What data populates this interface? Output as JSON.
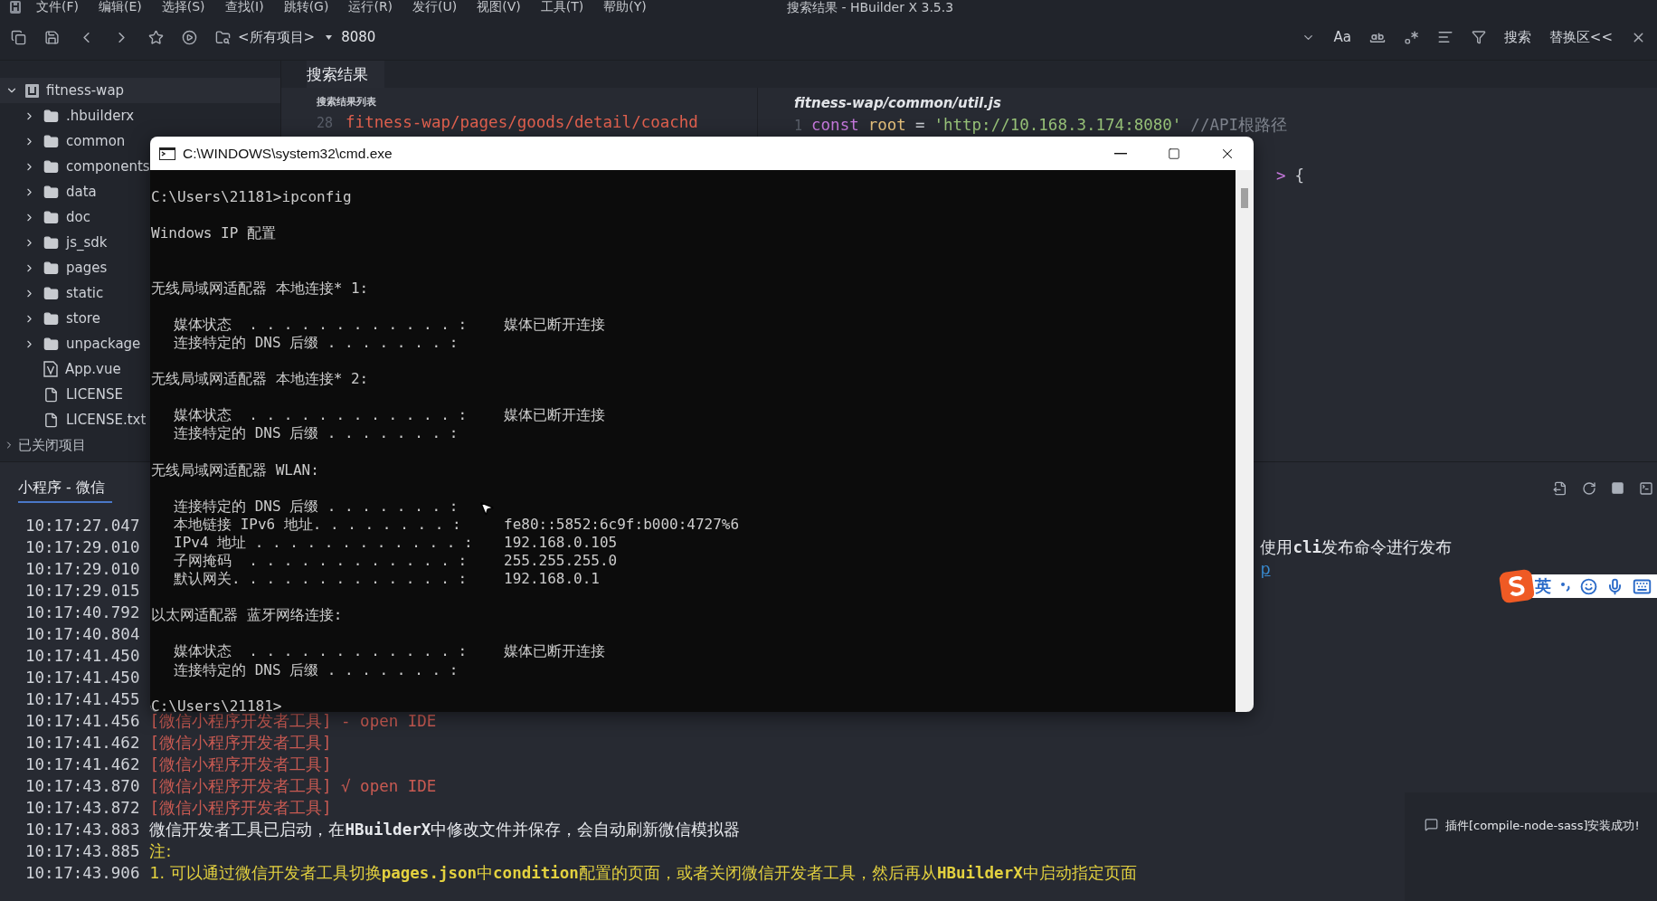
{
  "menu_bar": {
    "items": [
      "文件(F)",
      "编辑(E)",
      "选择(S)",
      "查找(I)",
      "跳转(G)",
      "运行(R)",
      "发行(U)",
      "视图(V)",
      "工具(T)",
      "帮助(Y)"
    ],
    "title": "搜索结果 - HBuilder X 3.5.3"
  },
  "toolbar": {
    "project_selector": "<所有项目>",
    "search_text": "8080",
    "match_case": "Aa",
    "search_button": "搜索",
    "replace_toggle": "替换区<<"
  },
  "sidebar": {
    "project": {
      "name": "fitness-wap",
      "expanded": true,
      "selected": true,
      "children": [
        {
          "name": ".hbuilderx",
          "kind": "folder",
          "expanded": false,
          "selected": false
        },
        {
          "name": "common",
          "kind": "folder",
          "expanded": false,
          "selected": false
        },
        {
          "name": "components",
          "kind": "folder",
          "expanded": false,
          "selected": false
        },
        {
          "name": "data",
          "kind": "folder",
          "expanded": false,
          "selected": false
        },
        {
          "name": "doc",
          "kind": "folder",
          "expanded": false,
          "selected": false
        },
        {
          "name": "js_sdk",
          "kind": "folder",
          "expanded": false,
          "selected": false
        },
        {
          "name": "pages",
          "kind": "folder",
          "expanded": false,
          "selected": false
        },
        {
          "name": "static",
          "kind": "folder",
          "expanded": false,
          "selected": false
        },
        {
          "name": "store",
          "kind": "folder",
          "expanded": false,
          "selected": false
        },
        {
          "name": "unpackage",
          "kind": "folder",
          "expanded": false,
          "selected": false
        },
        {
          "name": "App.vue",
          "kind": "vue",
          "selected": false
        },
        {
          "name": "LICENSE",
          "kind": "file",
          "selected": false
        },
        {
          "name": "LICENSE.txt",
          "kind": "file",
          "selected": false
        }
      ]
    },
    "closed_projects": {
      "label": "已关闭项目",
      "expanded": false
    }
  },
  "search_panel": {
    "tab": "搜索结果",
    "list_title": "搜索结果列表",
    "results": [
      {
        "line": "28",
        "text": "fitness-wap/pages/goods/detail/coachd"
      }
    ]
  },
  "editor": {
    "file_path": "fitness-wap/common/util.js",
    "lines": [
      {
        "number": "1",
        "tokens": [
          {
            "kind": "keyword",
            "text": "const"
          },
          {
            "kind": "name",
            "text": "root"
          },
          {
            "kind": "plain",
            "text": "="
          },
          {
            "kind": "string",
            "text": "'http://10.168.3.174:8080'"
          },
          {
            "kind": "comment",
            "text": "//API根路径"
          }
        ]
      },
      {
        "kind": "tail",
        "tokens": [
          {
            "kind": "keyword",
            "text": ">"
          },
          {
            "kind": "plain",
            "text": "{"
          }
        ]
      }
    ]
  },
  "console": {
    "tab": {
      "label": "小程序 - 微信",
      "selected": true
    },
    "rows": [
      {
        "time": "10:17:27.047",
        "kind": "hidden"
      },
      {
        "time": "10:17:29.010",
        "kind": "tail",
        "text": "使用**cli**发布命令进行发布"
      },
      {
        "time": "10:17:29.010",
        "kind": "link",
        "text": "p"
      },
      {
        "time": "10:17:29.015",
        "kind": "hidden"
      },
      {
        "time": "10:17:40.792",
        "kind": "hidden"
      },
      {
        "time": "10:17:40.804",
        "kind": "hidden"
      },
      {
        "time": "10:17:41.450",
        "kind": "hidden"
      },
      {
        "time": "10:17:41.450",
        "kind": "hidden"
      },
      {
        "time": "10:17:41.455",
        "kind": "hidden"
      },
      {
        "time": "10:17:41.456",
        "kind": "tool",
        "text": "[微信小程序开发者工具] - open IDE"
      },
      {
        "time": "10:17:41.462",
        "kind": "tool",
        "text": "[微信小程序开发者工具]"
      },
      {
        "time": "10:17:41.462",
        "kind": "tool",
        "text": "[微信小程序开发者工具]"
      },
      {
        "time": "10:17:43.870",
        "kind": "tool",
        "text": "[微信小程序开发者工具] √ open IDE"
      },
      {
        "time": "10:17:43.872",
        "kind": "tool",
        "text": "[微信小程序开发者工具]"
      },
      {
        "time": "10:17:43.883",
        "kind": "info",
        "text": "微信开发者工具已启动，在**HBuilderX**中修改文件并保存，会自动刷新微信模拟器"
      },
      {
        "time": "10:17:43.885",
        "kind": "note",
        "text": "注:"
      },
      {
        "time": "10:17:43.906",
        "kind": "note",
        "text": "1. 可以通过微信开发者工具切换**pages.json**中**condition**配置的页面，或者关闭微信开发者工具，然后再从**HBuilderX**中启动指定页面"
      }
    ]
  },
  "cmd_window": {
    "title": "C:\\WINDOWS\\system32\\cmd.exe",
    "lines": [
      {
        "kind": "blank"
      },
      {
        "kind": "text",
        "text": "C:\\Users\\21181>ipconfig"
      },
      {
        "kind": "blank"
      },
      {
        "kind": "text",
        "text": "Windows IP 配置"
      },
      {
        "kind": "blank"
      },
      {
        "kind": "blank"
      },
      {
        "kind": "text",
        "text": "无线局域网适配器 本地连接* 1:"
      },
      {
        "kind": "blank"
      },
      {
        "kind": "field",
        "label": "媒体状态  . . . . . . . . . . . . :",
        "value": "媒体已断开连接"
      },
      {
        "kind": "field",
        "label": "连接特定的 DNS 后缀 . . . . . . . :"
      },
      {
        "kind": "blank"
      },
      {
        "kind": "text",
        "text": "无线局域网适配器 本地连接* 2:"
      },
      {
        "kind": "blank"
      },
      {
        "kind": "field",
        "label": "媒体状态  . . . . . . . . . . . . :",
        "value": "媒体已断开连接"
      },
      {
        "kind": "field",
        "label": "连接特定的 DNS 后缀 . . . . . . . :"
      },
      {
        "kind": "blank"
      },
      {
        "kind": "text",
        "text": "无线局域网适配器 WLAN:"
      },
      {
        "kind": "blank"
      },
      {
        "kind": "field",
        "label": "连接特定的 DNS 后缀 . . . . . . . :"
      },
      {
        "kind": "field",
        "label": "本地链接 IPv6 地址. . . . . . . . :",
        "value": "fe80::5852:6c9f:b000:4727%6"
      },
      {
        "kind": "field",
        "label": "IPv4 地址 . . . . . . . . . . . . :",
        "value": "192.168.0.105"
      },
      {
        "kind": "field",
        "label": "子网掩码  . . . . . . . . . . . . :",
        "value": "255.255.255.0"
      },
      {
        "kind": "field",
        "label": "默认网关. . . . . . . . . . . . . :",
        "value": "192.168.0.1"
      },
      {
        "kind": "blank"
      },
      {
        "kind": "text",
        "text": "以太网适配器 蓝牙网络连接:"
      },
      {
        "kind": "blank"
      },
      {
        "kind": "field",
        "label": "媒体状态  . . . . . . . . . . . . :",
        "value": "媒体已断开连接"
      },
      {
        "kind": "field",
        "label": "连接特定的 DNS 后缀 . . . . . . . :"
      },
      {
        "kind": "blank"
      },
      {
        "kind": "text",
        "text": "C:\\Users\\21181>"
      }
    ]
  },
  "ime_bar": {
    "language": "英"
  },
  "notification": {
    "text": "插件[compile-node-sass]安装成功!"
  }
}
